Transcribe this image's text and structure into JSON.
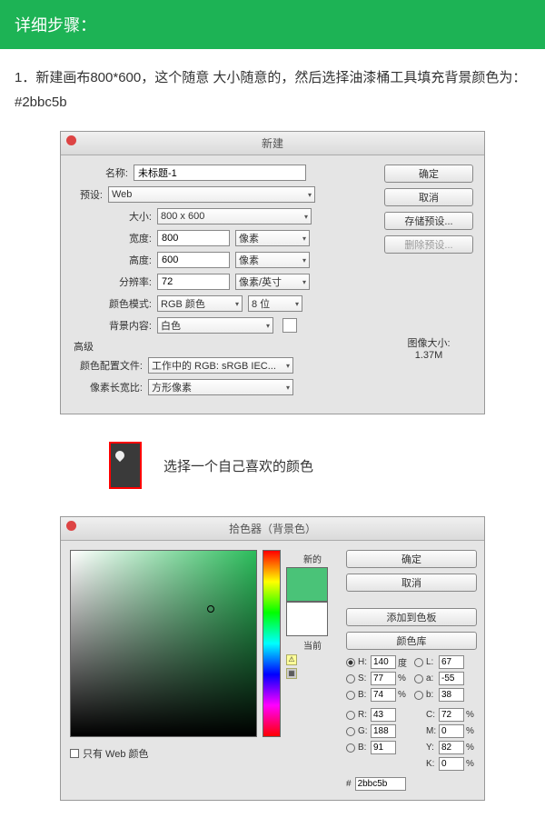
{
  "header": "详细步骤：",
  "step1": "1．新建画布800*600，这个随意  大小随意的，然后选择油漆桶工具填充背景颜色为：#2bbc5b",
  "newDlg": {
    "title": "新建",
    "name_lbl": "名称:",
    "name_val": "未标题-1",
    "preset_lbl": "预设:",
    "preset_val": "Web",
    "size_lbl": "大小:",
    "size_val": "800 x 600",
    "width_lbl": "宽度:",
    "width_val": "800",
    "width_unit": "像素",
    "height_lbl": "高度:",
    "height_val": "600",
    "height_unit": "像素",
    "res_lbl": "分辨率:",
    "res_val": "72",
    "res_unit": "像素/英寸",
    "mode_lbl": "颜色模式:",
    "mode_val": "RGB 颜色",
    "mode_bits": "8 位",
    "bg_lbl": "背景内容:",
    "bg_val": "白色",
    "adv_lbl": "高级",
    "profile_lbl": "颜色配置文件:",
    "profile_val": "工作中的 RGB: sRGB IEC...",
    "aspect_lbl": "像素长宽比:",
    "aspect_val": "方形像素",
    "ok": "确定",
    "cancel": "取消",
    "save": "存储预设...",
    "del": "删除预设...",
    "imgsize_lbl": "图像大小:",
    "imgsize_val": "1.37M"
  },
  "midText": "选择一个自己喜欢的颜色",
  "picker": {
    "title": "拾色器（背景色）",
    "new_lbl": "新的",
    "cur_lbl": "当前",
    "ok": "确定",
    "cancel": "取消",
    "add": "添加到色板",
    "lib": "颜色库",
    "webonly": "只有 Web 颜色",
    "H": "140",
    "S": "77",
    "B": "74",
    "R": "43",
    "G": "188",
    "Bl": "91",
    "L": "67",
    "a": "-55",
    "b": "38",
    "C": "72",
    "M": "0",
    "Y": "82",
    "K": "0",
    "hex": "2bbc5b"
  }
}
